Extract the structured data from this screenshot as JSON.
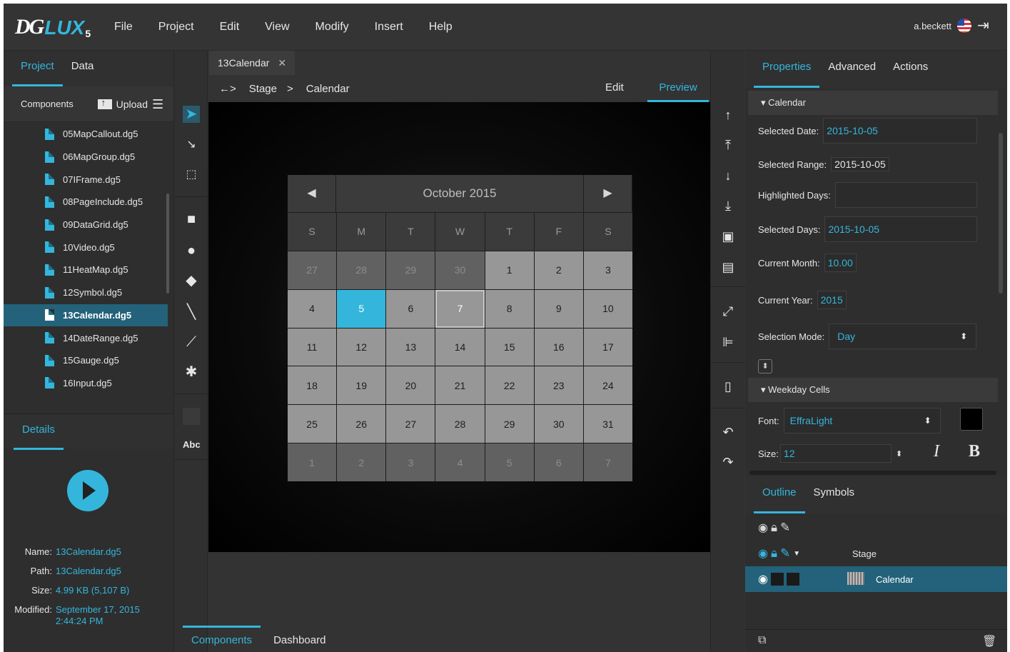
{
  "app": {
    "logo_main": "DG",
    "logo_lux": "LUX",
    "logo_version": "5",
    "menu": [
      "File",
      "Project",
      "Edit",
      "View",
      "Modify",
      "Insert",
      "Help"
    ],
    "user": "a.beckett"
  },
  "left_panel": {
    "tabs": [
      "Project",
      "Data"
    ],
    "components_label": "Components",
    "upload_label": "Upload",
    "files": [
      "05MapCallout.dg5",
      "06MapGroup.dg5",
      "07IFrame.dg5",
      "08PageInclude.dg5",
      "09DataGrid.dg5",
      "10Video.dg5",
      "11HeatMap.dg5",
      "12Symbol.dg5",
      "13Calendar.dg5",
      "14DateRange.dg5",
      "15Gauge.dg5",
      "16Input.dg5"
    ],
    "selected_file": "13Calendar.dg5",
    "details_tab": "Details",
    "details": {
      "name_key": "Name:",
      "name": "13Calendar.dg5",
      "path_key": "Path:",
      "path": "13Calendar.dg5",
      "size_key": "Size:",
      "size": "4.99 KB (5,107 B)",
      "modified_key": "Modified:",
      "modified": "September 17, 2015",
      "modified_time": "2:44:24 PM"
    }
  },
  "tools": {
    "text_tool": "Abc"
  },
  "document": {
    "tab": "13Calendar",
    "crumb_nav": "←>",
    "crumb_stage": "Stage",
    "crumb_sep": ">",
    "crumb_current": "Calendar",
    "mode_edit": "Edit",
    "mode_preview": "Preview"
  },
  "calendar": {
    "month_title": "October 2015",
    "prev": "◀",
    "next": "▶",
    "weekdays": [
      "S",
      "M",
      "T",
      "W",
      "T",
      "F",
      "S"
    ],
    "days": [
      {
        "d": "27",
        "t": "other"
      },
      {
        "d": "28",
        "t": "other"
      },
      {
        "d": "29",
        "t": "other"
      },
      {
        "d": "30",
        "t": "other"
      },
      {
        "d": "1",
        "t": "cur"
      },
      {
        "d": "2",
        "t": "cur"
      },
      {
        "d": "3",
        "t": "cur"
      },
      {
        "d": "4",
        "t": "cur"
      },
      {
        "d": "5",
        "t": "sel"
      },
      {
        "d": "6",
        "t": "cur"
      },
      {
        "d": "7",
        "t": "hov"
      },
      {
        "d": "8",
        "t": "cur"
      },
      {
        "d": "9",
        "t": "cur"
      },
      {
        "d": "10",
        "t": "cur"
      },
      {
        "d": "11",
        "t": "cur"
      },
      {
        "d": "12",
        "t": "cur"
      },
      {
        "d": "13",
        "t": "cur"
      },
      {
        "d": "14",
        "t": "cur"
      },
      {
        "d": "15",
        "t": "cur"
      },
      {
        "d": "16",
        "t": "cur"
      },
      {
        "d": "17",
        "t": "cur"
      },
      {
        "d": "18",
        "t": "cur"
      },
      {
        "d": "19",
        "t": "cur"
      },
      {
        "d": "20",
        "t": "cur"
      },
      {
        "d": "21",
        "t": "cur"
      },
      {
        "d": "22",
        "t": "cur"
      },
      {
        "d": "23",
        "t": "cur"
      },
      {
        "d": "24",
        "t": "cur"
      },
      {
        "d": "25",
        "t": "cur"
      },
      {
        "d": "26",
        "t": "cur"
      },
      {
        "d": "27",
        "t": "cur"
      },
      {
        "d": "28",
        "t": "cur"
      },
      {
        "d": "29",
        "t": "cur"
      },
      {
        "d": "30",
        "t": "cur"
      },
      {
        "d": "31",
        "t": "cur"
      },
      {
        "d": "1",
        "t": "other"
      },
      {
        "d": "2",
        "t": "other"
      },
      {
        "d": "3",
        "t": "other"
      },
      {
        "d": "4",
        "t": "other"
      },
      {
        "d": "5",
        "t": "other"
      },
      {
        "d": "6",
        "t": "other"
      },
      {
        "d": "7",
        "t": "other"
      }
    ]
  },
  "properties": {
    "tabs": [
      "Properties",
      "Advanced",
      "Actions"
    ],
    "section_calendar": "▾ Calendar",
    "selected_date_label": "Selected Date:",
    "selected_date": "2015-10-05",
    "selected_range_label": "Selected Range:",
    "selected_range": "2015-10-05",
    "highlighted_days_label": "Highlighted Days:",
    "highlighted_days": "",
    "selected_days_label": "Selected Days:",
    "selected_days": "2015-10-05",
    "current_month_label": "Current Month:",
    "current_month": "10.00",
    "current_year_label": "Current Year:",
    "current_year": "2015",
    "selection_mode_label": "Selection Mode:",
    "selection_mode": "Day",
    "section_weekday": "▾ Weekday Cells",
    "font_label": "Font:",
    "font": "EffraLight",
    "size_label": "Size:",
    "size": "12",
    "italic": "I",
    "bold": "B"
  },
  "outline": {
    "tabs": [
      "Outline",
      "Symbols"
    ],
    "stage": "Stage",
    "calendar": "Calendar"
  },
  "bottom_tabs": [
    "Components",
    "Dashboard"
  ],
  "colors": {
    "accent": "#34b6dc",
    "selected_row": "#23627a",
    "panel": "#2e2e2e"
  }
}
